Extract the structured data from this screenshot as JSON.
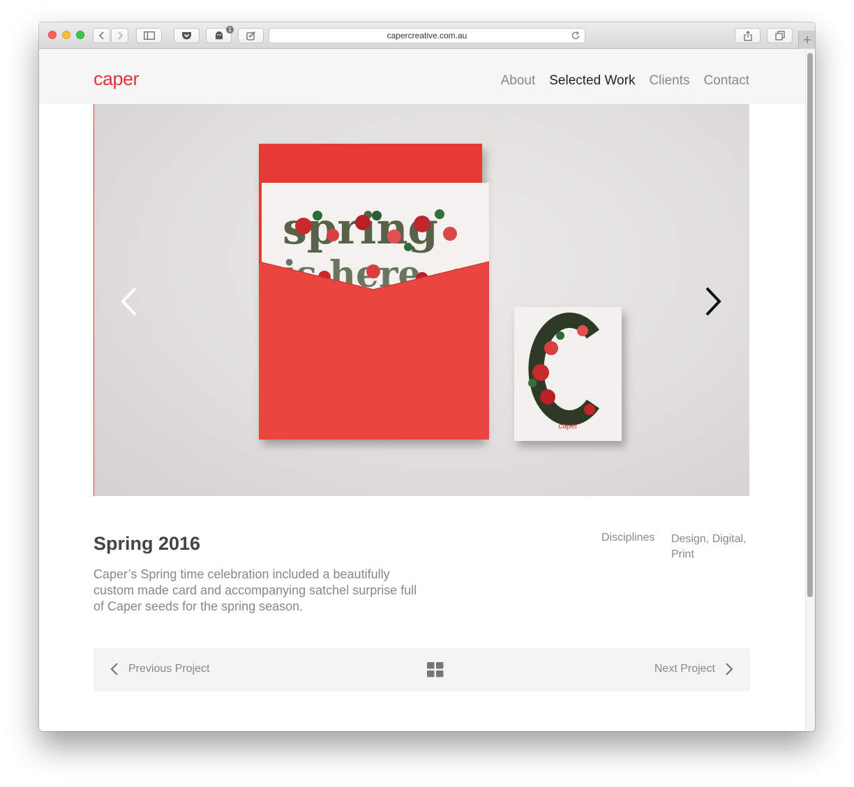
{
  "browser": {
    "url": "capercreative.com.au",
    "badge_count": "1"
  },
  "site": {
    "logo": "caper",
    "nav": [
      {
        "label": "About",
        "active": false
      },
      {
        "label": "Selected Work",
        "active": true
      },
      {
        "label": "Clients",
        "active": false
      },
      {
        "label": "Contact",
        "active": false
      }
    ]
  },
  "hero": {
    "image_description_icon": "spring-card-envelope-photo",
    "card_logo": "caper",
    "prev_icon": "chevron-left-icon",
    "next_icon": "chevron-right-icon"
  },
  "project": {
    "title": "Spring 2016",
    "description": "Caper’s Spring time celebration included a beautifully custom made card and accompanying satchel surprise full of Caper seeds for the spring season.",
    "disciplines_label": "Disciplines",
    "disciplines_value": "Design, Digital, Print"
  },
  "pager": {
    "prev_label": "Previous Project",
    "next_label": "Next Project"
  },
  "colors": {
    "brand_red": "#e8313f",
    "envelope_red": "#e8463f",
    "hero_bg": "#e4e3df"
  }
}
